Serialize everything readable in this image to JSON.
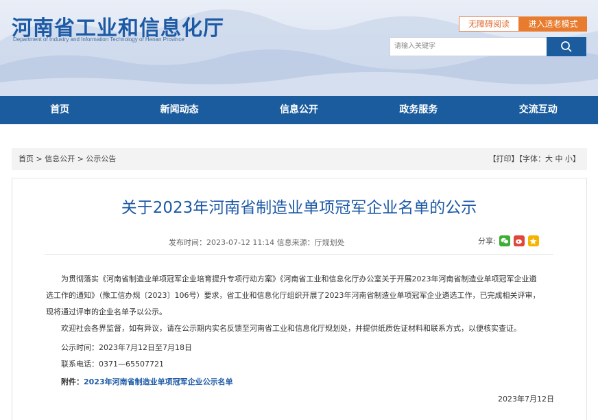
{
  "header": {
    "title": "河南省工业和信息化厅",
    "subtitle": "Department of Industry and Information Technology of Henan Province",
    "accessible_btn": "无障碍阅读",
    "elder_btn": "进入适老模式",
    "search_placeholder": "请输入关键字"
  },
  "nav": {
    "items": [
      "首页",
      "新闻动态",
      "信息公开",
      "政务服务",
      "交流互动"
    ]
  },
  "breadcrumb": {
    "path": "首页 > 信息公开 > 公示公告",
    "tools": "【打印】【字体：大 中 小】"
  },
  "article": {
    "title": "关于2023年河南省制造业单项冠军企业名单的公示",
    "meta": "发布时间：2023-07-12 11:14   信息来源：厅规划处",
    "share_label": "分享:",
    "p1_line1": "为贯彻落实《河南省制造业单项冠军企业培育提升专项行动方案》《河南省工业和信息化厅办公室关于开展2023年河南省制造业单项冠军企业遴",
    "p1_line2": "选工作的通知》（豫工信办规〔2023〕106号）要求，省工业和信息化厅组织开展了2023年河南省制造业单项冠军企业遴选工作，已完成相关评审，",
    "p1_line3": "现将通过评审的企业名单予以公示。",
    "p2": "欢迎社会各界监督，如有异议，请在公示期内实名反馈至河南省工业和信息化厅规划处，并提供纸质佐证材料和联系方式，以便核实查证。",
    "p3": "公示时间：2023年7月12日至7月18日",
    "p4": "联系电话：0371—65507721",
    "attach_label": "附件：",
    "attach_link": "2023年河南省制造业单项冠军企业公示名单",
    "date": "2023年7月12日"
  },
  "colors": {
    "brand_blue": "#1b5c9e",
    "orange": "#e87b2d",
    "wechat": "#3cb034",
    "weibo": "#e0463a",
    "fav": "#f5b400"
  }
}
